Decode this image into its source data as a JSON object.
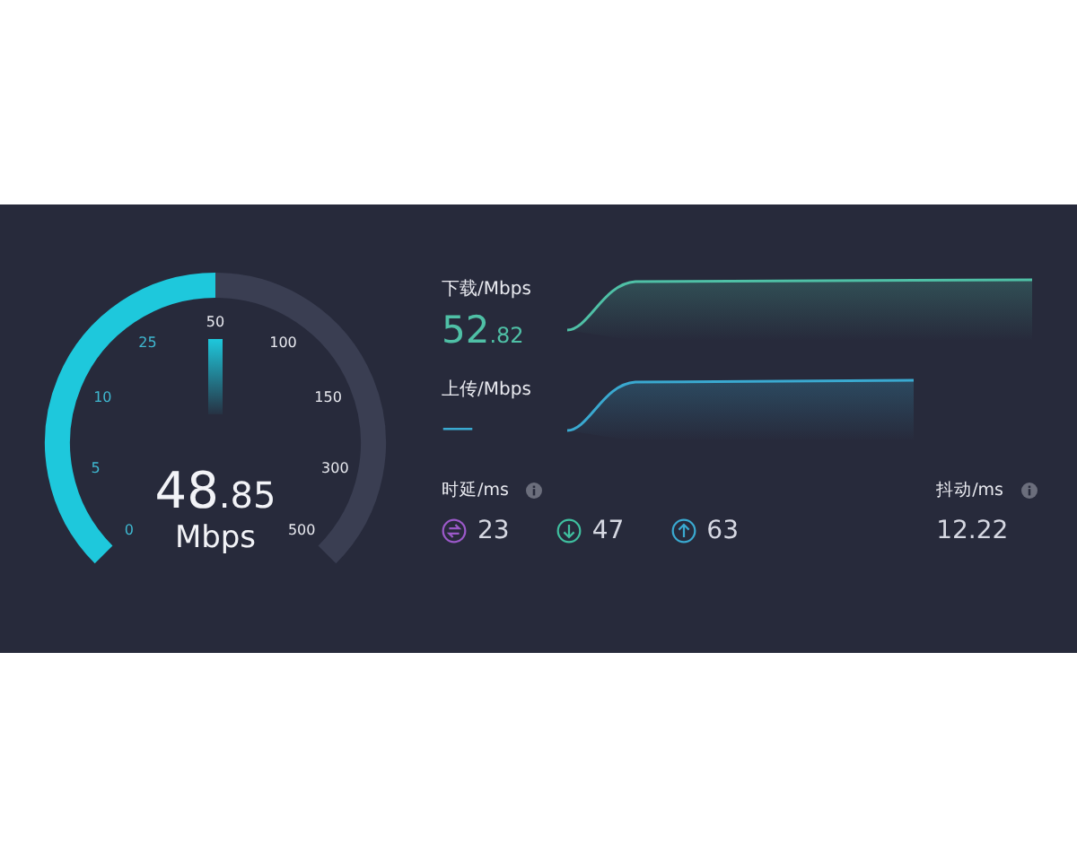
{
  "gauge": {
    "value_int": "48",
    "value_frac": ".85",
    "unit": "Mbps",
    "ticks": [
      "0",
      "5",
      "10",
      "25",
      "50",
      "100",
      "150",
      "300",
      "500"
    ]
  },
  "metrics": [
    {
      "kind": "download",
      "label": "下载/Mbps",
      "value_int": "52",
      "value_frac": ".82"
    },
    {
      "kind": "upload",
      "label": "上传/Mbps",
      "value_int": "—"
    }
  ],
  "latency": {
    "label": "时延/ms",
    "items": [
      {
        "kind": "idle",
        "color": "#9b59c9",
        "value": "23"
      },
      {
        "kind": "download",
        "color": "#3fbf9f",
        "value": "47"
      },
      {
        "kind": "upload",
        "color": "#3aa9d0",
        "value": "63"
      }
    ]
  },
  "jitter": {
    "label": "抖动/ms",
    "value": "12.22"
  }
}
